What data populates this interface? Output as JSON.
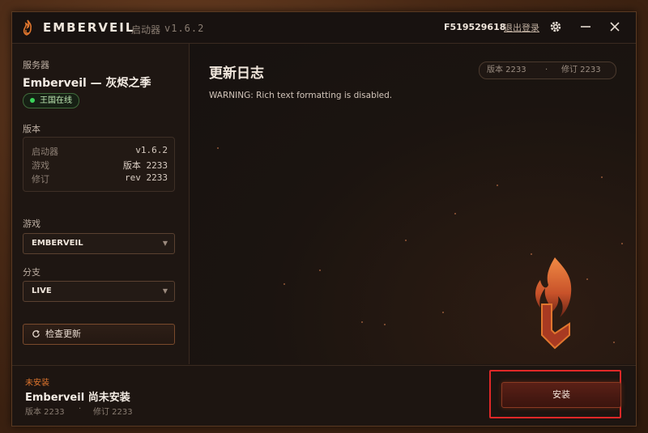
{
  "app": {
    "name": "EMBERVEIL",
    "subtitle": "启动器",
    "version": "v1.6.2",
    "user_id": "F519529618",
    "logout_label": "退出登录"
  },
  "sidebar": {
    "server_label": "服务器",
    "server_name": "Emberveil — 灰烬之季",
    "status": "王国在线",
    "version_label": "版本",
    "versions": [
      {
        "label": "启动器",
        "value": "v1.6.2"
      },
      {
        "label": "游戏",
        "value": "版本 2233"
      },
      {
        "label": "修订",
        "value": "rev 2233"
      }
    ],
    "game_label": "游戏",
    "game_value": "EMBERVEIL",
    "branch_label": "分支",
    "branch_value": "LIVE",
    "check_update_label": "检查更新"
  },
  "main": {
    "title": "更新日志",
    "version_pill": {
      "version": "版本 2233",
      "separator": "·",
      "revision": "修订 2233"
    },
    "warning": "WARNING: Rich text formatting is disabled."
  },
  "bottom": {
    "status": "未安装",
    "title": "Emberveil 尚未安装",
    "meta": {
      "version": "版本 2233",
      "separator": "·",
      "revision": "修订 2233"
    },
    "install_label": "安装"
  },
  "colors": {
    "accent": "#e0762e",
    "online": "#3bd25a",
    "highlight": "#e02828"
  },
  "icons": [
    "flame-logo-icon",
    "gear-icon",
    "minimize-icon",
    "close-icon",
    "refresh-icon",
    "chevron-down-icon",
    "flame-emblem-icon"
  ]
}
